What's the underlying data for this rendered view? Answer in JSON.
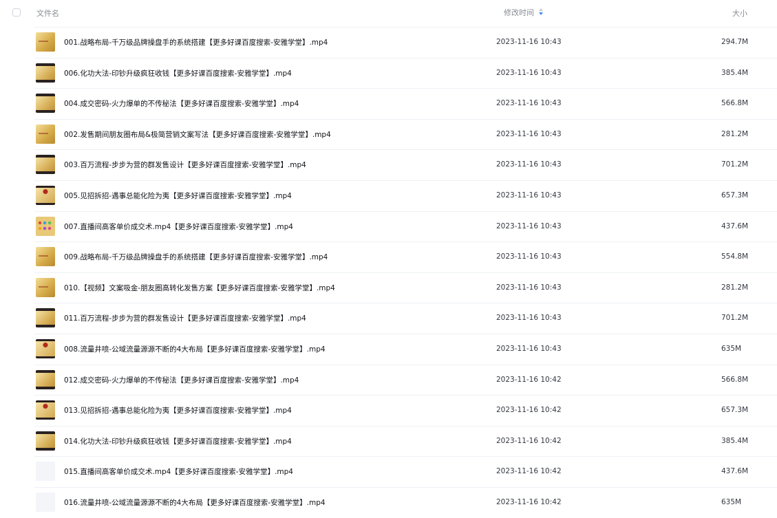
{
  "header": {
    "name_label": "文件名",
    "time_label": "修改时间",
    "size_label": "大小",
    "sort_icon": "sort-arrows-icon"
  },
  "files": [
    {
      "name": "001.战略布局-千万级品牌操盘手的系统搭建【更多好课百度搜索-安雅学堂】.mp4",
      "time": "2023-11-16 10:43",
      "size": "294.7M",
      "thumb": "gold"
    },
    {
      "name": "006.化功大法-印钞升级疯狂收钱【更多好课百度搜索-安雅学堂】.mp4",
      "time": "2023-11-16 10:43",
      "size": "385.4M",
      "thumb": "dark"
    },
    {
      "name": "004.成交密码-火力爆单的不传秘法【更多好课百度搜索-安雅学堂】.mp4",
      "time": "2023-11-16 10:43",
      "size": "566.8M",
      "thumb": "dark"
    },
    {
      "name": "002.发售期间朋友圈布局&极简营销文案写法【更多好课百度搜索-安雅学堂】.mp4",
      "time": "2023-11-16 10:43",
      "size": "281.2M",
      "thumb": "gold"
    },
    {
      "name": "003.百万流程-步步为营的群发售设计【更多好课百度搜索-安雅学堂】.mp4",
      "time": "2023-11-16 10:43",
      "size": "701.2M",
      "thumb": "dark"
    },
    {
      "name": "005.见招拆招-遇事总能化险为夷【更多好课百度搜索-安雅学堂】.mp4",
      "time": "2023-11-16 10:43",
      "size": "657.3M",
      "thumb": "red"
    },
    {
      "name": "007.直播间高客单价成交术.mp4【更多好课百度搜索-安雅学堂】.mp4",
      "time": "2023-11-16 10:43",
      "size": "437.6M",
      "thumb": "colorful"
    },
    {
      "name": "009.战略布局-千万级品牌操盘手的系统搭建【更多好课百度搜索-安雅学堂】.mp4",
      "time": "2023-11-16 10:43",
      "size": "554.8M",
      "thumb": "gold"
    },
    {
      "name": "010.【视频】文案吸金-朋友圈高转化发售方案【更多好课百度搜索-安雅学堂】.mp4",
      "time": "2023-11-16 10:43",
      "size": "281.2M",
      "thumb": "gold"
    },
    {
      "name": "011.百万流程-步步为营的群发售设计【更多好课百度搜索-安雅学堂】.mp4",
      "time": "2023-11-16 10:43",
      "size": "701.2M",
      "thumb": "dark"
    },
    {
      "name": "008.流量井喷-公域流量源源不断的4大布局【更多好课百度搜索-安雅学堂】.mp4",
      "time": "2023-11-16 10:43",
      "size": "635M",
      "thumb": "red"
    },
    {
      "name": "012.成交密码-火力爆单的不传秘法【更多好课百度搜索-安雅学堂】.mp4",
      "time": "2023-11-16 10:42",
      "size": "566.8M",
      "thumb": "dark"
    },
    {
      "name": "013.见招拆招-遇事总能化险为夷【更多好课百度搜索-安雅学堂】.mp4",
      "time": "2023-11-16 10:42",
      "size": "657.3M",
      "thumb": "red"
    },
    {
      "name": "014.化功大法-印钞升级疯狂收钱【更多好课百度搜索-安雅学堂】.mp4",
      "time": "2023-11-16 10:42",
      "size": "385.4M",
      "thumb": "dark"
    },
    {
      "name": "015.直播间高客单价成交术.mp4【更多好课百度搜索-安雅学堂】.mp4",
      "time": "2023-11-16 10:42",
      "size": "437.6M",
      "thumb": "blank"
    },
    {
      "name": "016.流量井喷-公域流量源源不断的4大布局【更多好课百度搜索-安雅学堂】.mp4",
      "time": "2023-11-16 10:42",
      "size": "635M",
      "thumb": "blank"
    }
  ]
}
